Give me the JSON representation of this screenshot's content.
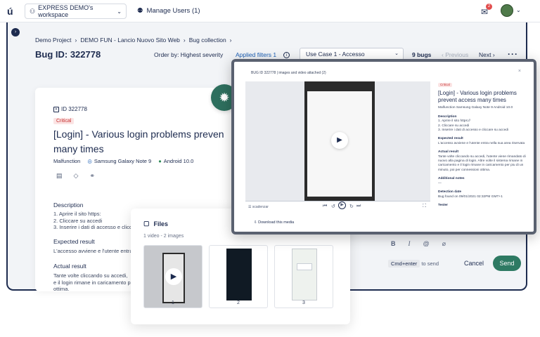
{
  "topbar": {
    "logo": "ú",
    "workspace": "EXPRESS DEMO's workspace",
    "manage_users": "Manage Users (1)",
    "notification_count": "2"
  },
  "breadcrumb": [
    "Demo Project",
    "DEMO FUN - Lancio Nuovo Sito Web",
    "Bug collection"
  ],
  "header": {
    "bug_id": "Bug ID: 322778",
    "order_by": "Order by: Highest severity",
    "applied_filters": "Applied filters 1",
    "use_case": "Use Case 1 - Accesso",
    "bugs_count": "9 bugs",
    "previous": "‹ Previous",
    "next": "Next ›",
    "more": "···"
  },
  "bug_card": {
    "id": "ID 322778",
    "severity": "Critical",
    "title": "[Login] - Various login problems preven\nmany times",
    "type": "Malfunction",
    "device": "Samsung Galaxy Note 9",
    "os": "Android 10.0",
    "description_label": "Description",
    "description": "1. Aprire il sito https:\n2. Cliccare su accedi\n3. Inserire i dati di accesso e clicc",
    "expected_label": "Expected result",
    "expected": "L'accesso avviene e l'utente entra",
    "actual_label": "Actual result",
    "actual": "Tante volte cliccando su accedi,\ne il login rimane in caricamento p\nottima."
  },
  "files": {
    "title": "Files",
    "subtitle": "1 video - 2 images",
    "items": [
      "1",
      "2",
      "3"
    ]
  },
  "modal": {
    "title": "BUG ID 322778 | images and video attached (2)",
    "close": "×",
    "download": "Download this media",
    "controls_left": "☰  scadenzar",
    "panel": {
      "severity": "Critical",
      "title": "[Login] - Various login problems prevent access many times",
      "meta": "Malfunction    Samsung Galaxy Note 9    Android 10.0",
      "description_label": "Description",
      "description": "1. Aprire il sito https://\n2. Cliccare su accedi\n3. Inserire i dati di accesso e cliccare su accedi",
      "expected_label": "Expected result",
      "expected": "L'accesso avviene e l'utente entra nella sua area riservata",
      "actual_label": "Actual result",
      "actual": "Tante volte cliccando su accedi, l'utente viene rimandato di nuovo alla pagina di login. Altre volte il sistema rimane in caricamento e il login rimane in caricamento per piu di un minuto, poi per connessioni ottima.",
      "notes_label": "Additional notes",
      "notes": "—",
      "detection_label": "Detection date",
      "detection": "Bug found on 09/01/2021 02:32PM GMT+1",
      "tester_label": "Tester"
    }
  },
  "comment": {
    "bold": "B",
    "italic": "I",
    "mention": "@",
    "attach": "⌀",
    "shortcut_key": "Cmd+enter",
    "shortcut_text": "to send",
    "cancel": "Cancel",
    "send": "Send"
  },
  "colors": {
    "brand_green": "#2e7a63",
    "navy": "#1d2b4f",
    "critical": "#c62f2f",
    "link": "#1b5eb5"
  }
}
